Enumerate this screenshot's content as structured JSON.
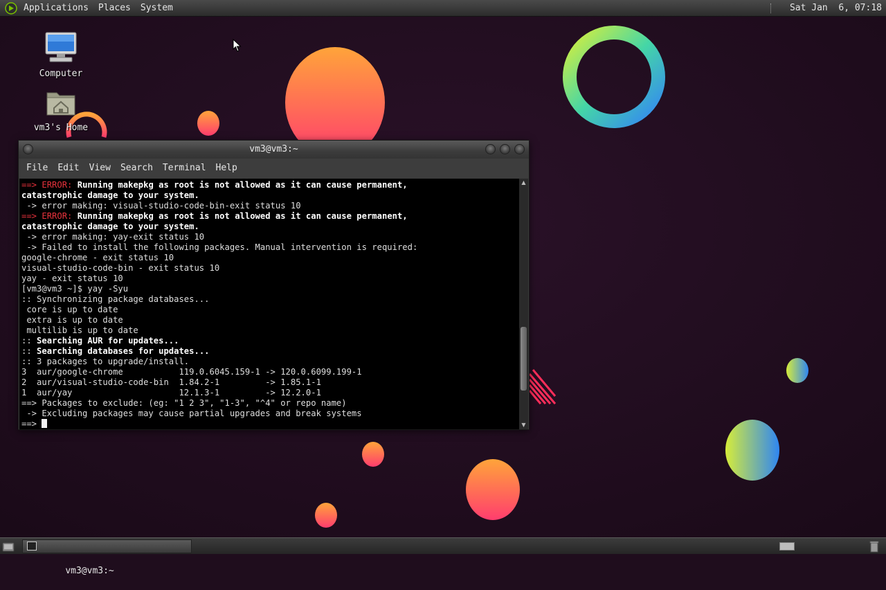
{
  "top_panel": {
    "menus": [
      "Applications",
      "Places",
      "System"
    ],
    "clock": "Sat Jan  6, 07:18"
  },
  "desktop": {
    "icons": [
      {
        "label": "Computer",
        "icon": "computer-icon"
      },
      {
        "label": "vm3's Home",
        "icon": "home-folder-icon"
      }
    ]
  },
  "window": {
    "title": "vm3@vm3:~",
    "menus": [
      "File",
      "Edit",
      "View",
      "Search",
      "Terminal",
      "Help"
    ],
    "terminal_lines": [
      [
        {
          "t": "==> ",
          "c": "red"
        },
        {
          "t": "ERROR: ",
          "c": "red"
        },
        {
          "t": "Running makepkg as root is not allowed as it can cause permanent,",
          "c": "bold"
        }
      ],
      [
        {
          "t": "catastrophic damage to your system.",
          "c": "bold"
        }
      ],
      [
        {
          "t": " -> error making: visual-studio-code-bin-exit status 10",
          "c": ""
        }
      ],
      [
        {
          "t": "==> ",
          "c": "red"
        },
        {
          "t": "ERROR: ",
          "c": "red"
        },
        {
          "t": "Running makepkg as root is not allowed as it can cause permanent,",
          "c": "bold"
        }
      ],
      [
        {
          "t": "catastrophic damage to your system.",
          "c": "bold"
        }
      ],
      [
        {
          "t": " -> error making: yay-exit status 10",
          "c": ""
        }
      ],
      [
        {
          "t": " -> Failed to install the following packages. Manual intervention is required:",
          "c": ""
        }
      ],
      [
        {
          "t": "google-chrome - exit status 10",
          "c": ""
        }
      ],
      [
        {
          "t": "visual-studio-code-bin - exit status 10",
          "c": ""
        }
      ],
      [
        {
          "t": "yay - exit status 10",
          "c": ""
        }
      ],
      [
        {
          "t": "[vm3@vm3 ~]$ yay -Syu",
          "c": ""
        }
      ],
      [
        {
          "t": ":: Synchronizing package databases...",
          "c": ""
        }
      ],
      [
        {
          "t": " core is up to date",
          "c": ""
        }
      ],
      [
        {
          "t": " extra is up to date",
          "c": ""
        }
      ],
      [
        {
          "t": " multilib is up to date",
          "c": ""
        }
      ],
      [
        {
          "t": ":: ",
          "c": ""
        },
        {
          "t": "Searching AUR for updates...",
          "c": "bold"
        }
      ],
      [
        {
          "t": ":: ",
          "c": ""
        },
        {
          "t": "Searching databases for updates...",
          "c": "bold"
        }
      ],
      [
        {
          "t": ":: 3 packages to upgrade/install.",
          "c": ""
        }
      ],
      [
        {
          "t": "3  aur/google-chrome           119.0.6045.159-1 -> 120.0.6099.199-1",
          "c": ""
        }
      ],
      [
        {
          "t": "2  aur/visual-studio-code-bin  1.84.2-1         -> 1.85.1-1",
          "c": ""
        }
      ],
      [
        {
          "t": "1  aur/yay                     12.1.3-1         -> 12.2.0-1",
          "c": ""
        }
      ],
      [
        {
          "t": "==> Packages to exclude: (eg: \"1 2 3\", \"1-3\", \"^4\" or repo name)",
          "c": ""
        }
      ],
      [
        {
          "t": " -> Excluding packages may cause partial upgrades and break systems",
          "c": ""
        }
      ],
      [
        {
          "t": "==> ",
          "c": ""
        }
      ]
    ],
    "scroll_position": 0.82
  },
  "bottom_panel": {
    "task_label": "vm3@vm3:~"
  },
  "colors": {
    "error_red": "#e8323c",
    "terminal_bg": "#000000",
    "wallpaper_bg": "#1f0d1d"
  }
}
